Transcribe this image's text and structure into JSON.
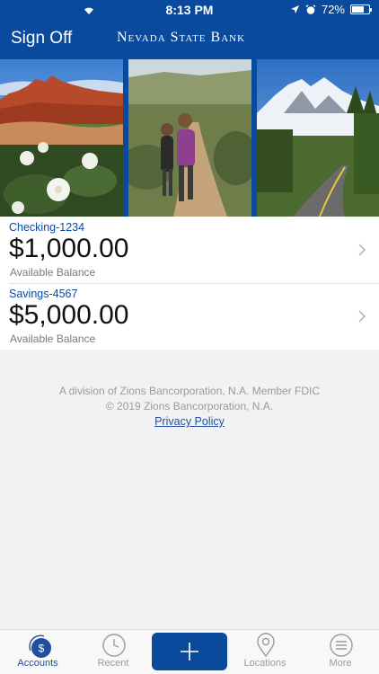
{
  "status_bar": {
    "time": "8:13 PM",
    "battery": "72%",
    "battery_level": 0.72
  },
  "nav": {
    "left_label": "Sign Off",
    "brand": "Nevada State Bank"
  },
  "photos": [
    {
      "icon": "red-rock-desert-photo"
    },
    {
      "icon": "hikers-trail-photo"
    },
    {
      "icon": "mountain-road-photo"
    }
  ],
  "accounts": [
    {
      "name": "Checking-1234",
      "balance": "$1,000.00",
      "balance_label": "Available Balance"
    },
    {
      "name": "Savings-4567",
      "balance": "$5,000.00",
      "balance_label": "Available Balance"
    }
  ],
  "legal": {
    "line1": "A division of Zions Bancorporation, N.A. Member FDIC",
    "line2": "© 2019 Zions Bancorporation, N.A.",
    "privacy": "Privacy Policy"
  },
  "tabs": [
    {
      "label": "Accounts",
      "icon": "dollar-circle-icon",
      "active": true
    },
    {
      "label": "Recent",
      "icon": "clock-icon",
      "active": false
    },
    {
      "label": "",
      "icon": "plus-icon",
      "active": false
    },
    {
      "label": "Locations",
      "icon": "map-pin-icon",
      "active": false
    },
    {
      "label": "More",
      "icon": "menu-lines-icon",
      "active": false
    }
  ],
  "colors": {
    "brand_blue": "#0a4a9c",
    "link_blue": "#1f4f9e",
    "background": "#f2f2f4"
  }
}
